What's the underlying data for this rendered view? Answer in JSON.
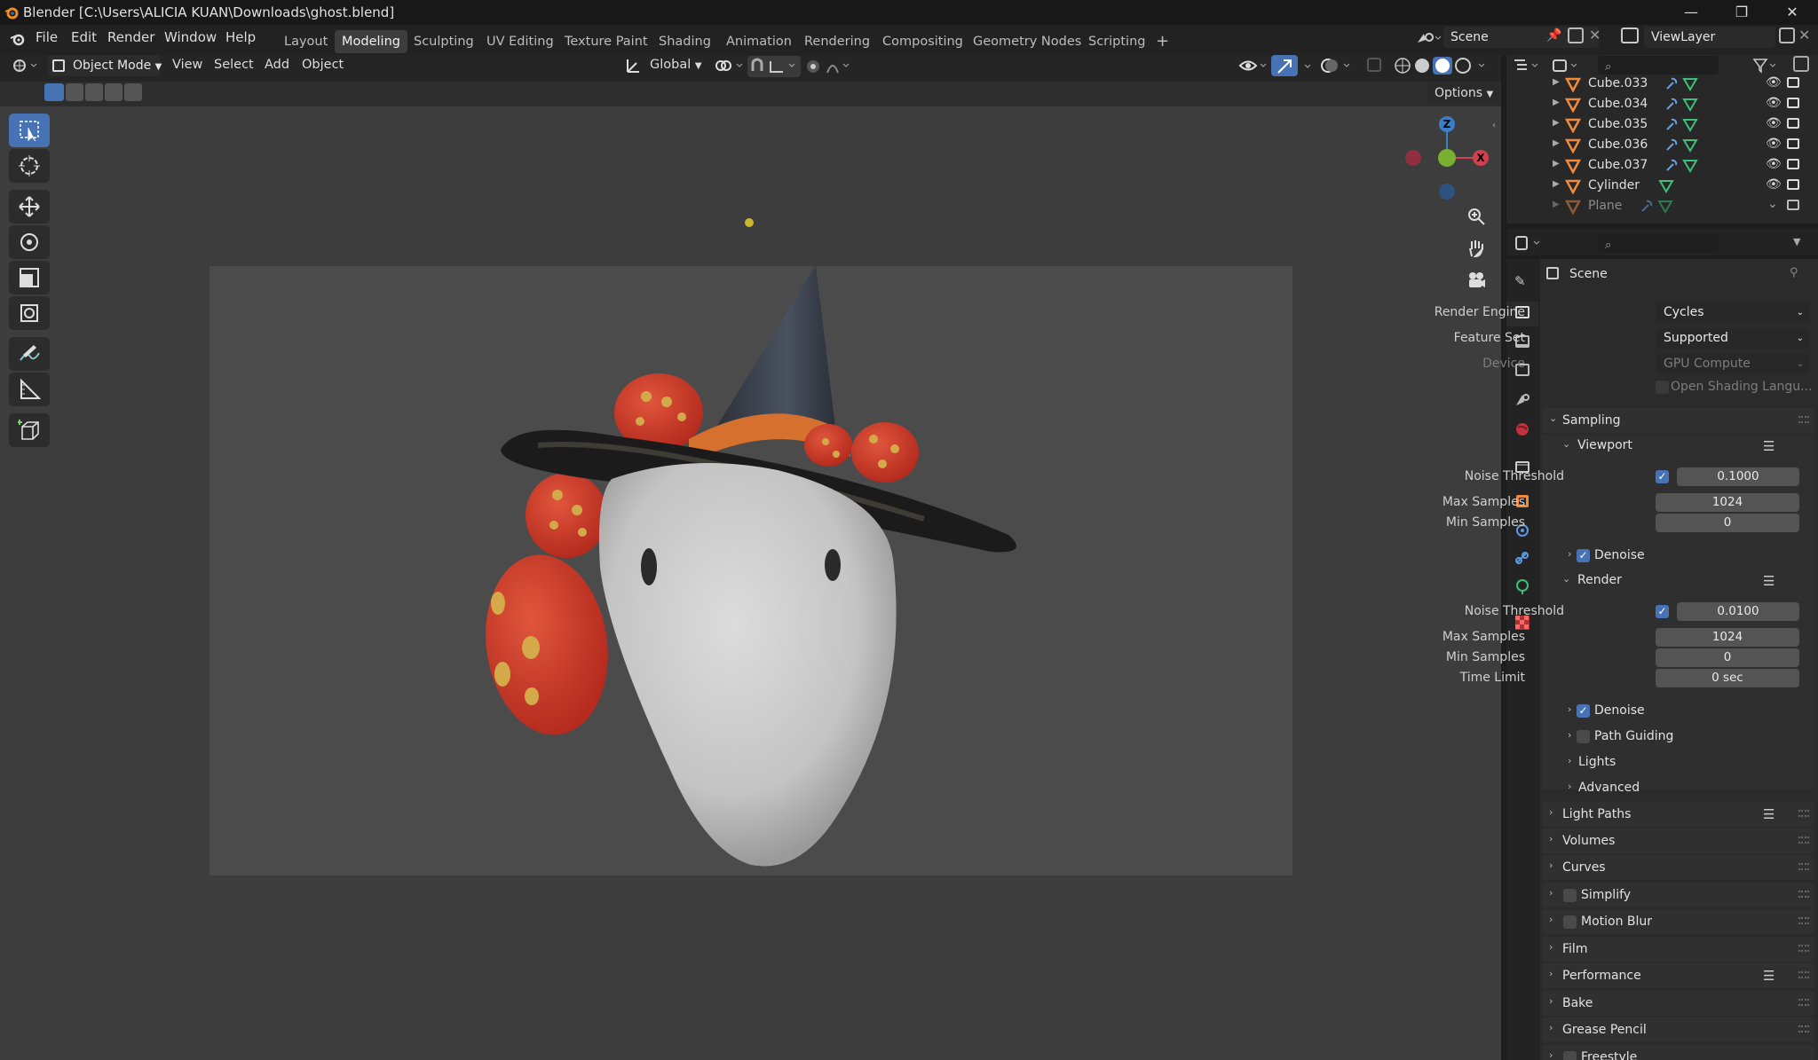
{
  "window": {
    "title": "Blender [C:\\Users\\ALICIA KUAN\\Downloads\\ghost.blend]",
    "minimize": "—",
    "maximize": "❐",
    "close": "✕"
  },
  "menus": [
    "File",
    "Edit",
    "Render",
    "Window",
    "Help"
  ],
  "workspaces": [
    "Layout",
    "Modeling",
    "Sculpting",
    "UV Editing",
    "Texture Paint",
    "Shading",
    "Animation",
    "Rendering",
    "Compositing",
    "Geometry Nodes",
    "Scripting"
  ],
  "active_workspace": "Modeling",
  "add_workspace": "+",
  "scene_name": "Scene",
  "view_layer": "ViewLayer",
  "viewport": {
    "mode": "Object Mode",
    "menus": [
      "View",
      "Select",
      "Add",
      "Object"
    ],
    "transform_orientation": "Global",
    "options_label": "Options",
    "gizmo_axes": {
      "z": "Z",
      "x": "X"
    },
    "tools": [
      "select-box",
      "cursor",
      "move",
      "rotate",
      "scale",
      "transform",
      "annotate",
      "measure",
      "add-cube"
    ],
    "active_tool": "select-box"
  },
  "outliner": {
    "rows": [
      {
        "name": "Cube.033",
        "modifier": true,
        "dim": false
      },
      {
        "name": "Cube.034",
        "modifier": true,
        "dim": false
      },
      {
        "name": "Cube.035",
        "modifier": true,
        "dim": false
      },
      {
        "name": "Cube.036",
        "modifier": true,
        "dim": false
      },
      {
        "name": "Cube.037",
        "modifier": true,
        "dim": false
      },
      {
        "name": "Cylinder",
        "modifier": false,
        "dim": false
      },
      {
        "name": "Plane",
        "modifier": true,
        "dim": true
      }
    ]
  },
  "properties": {
    "context": "Scene",
    "render_engine_label": "Render Engine",
    "render_engine": "Cycles",
    "feature_set_label": "Feature Set",
    "feature_set": "Supported",
    "device_label": "Device",
    "device": "GPU Compute",
    "osl_label": "Open Shading Langu...",
    "sampling": {
      "title": "Sampling",
      "viewport": {
        "title": "Viewport",
        "noise_threshold_label": "Noise Threshold",
        "noise_threshold": "0.1000",
        "max_samples_label": "Max Samples",
        "max_samples": "1024",
        "min_samples_label": "Min Samples",
        "min_samples": "0",
        "denoise_label": "Denoise"
      },
      "render": {
        "title": "Render",
        "noise_threshold_label": "Noise Threshold",
        "noise_threshold": "0.0100",
        "max_samples_label": "Max Samples",
        "max_samples": "1024",
        "min_samples_label": "Min Samples",
        "min_samples": "0",
        "time_limit_label": "Time Limit",
        "time_limit": "0 sec",
        "denoise_label": "Denoise",
        "path_guiding_label": "Path Guiding"
      },
      "lights_label": "Lights",
      "advanced_label": "Advanced"
    },
    "panels": [
      "Light Paths",
      "Volumes",
      "Curves",
      "Simplify",
      "Motion Blur",
      "Film",
      "Performance",
      "Bake",
      "Grease Pencil",
      "Freestyle"
    ]
  }
}
